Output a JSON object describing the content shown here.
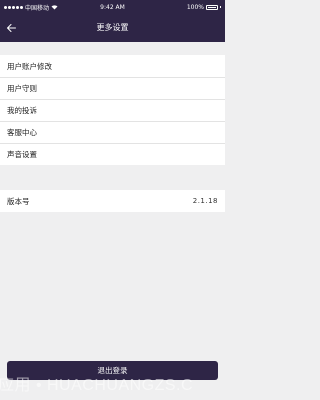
{
  "status_bar": {
    "carrier": "中国移动",
    "time": "9:42 AM",
    "battery": "100%"
  },
  "nav": {
    "title": "更多设置",
    "back_icon": "arrow-left-icon"
  },
  "settings": {
    "items": [
      {
        "label": "用户账户修改"
      },
      {
        "label": "用户守则"
      },
      {
        "label": "我的投诉"
      },
      {
        "label": "客服中心"
      },
      {
        "label": "声音设置"
      }
    ],
    "version": {
      "label": "版本号",
      "value": "2.1.18"
    }
  },
  "logout": {
    "label": "退出登录"
  },
  "watermark": "应用 • HUACHUANGZS.C",
  "colors": {
    "primary": "#2e2546",
    "background": "#efeff0",
    "row_background": "#ffffff"
  }
}
